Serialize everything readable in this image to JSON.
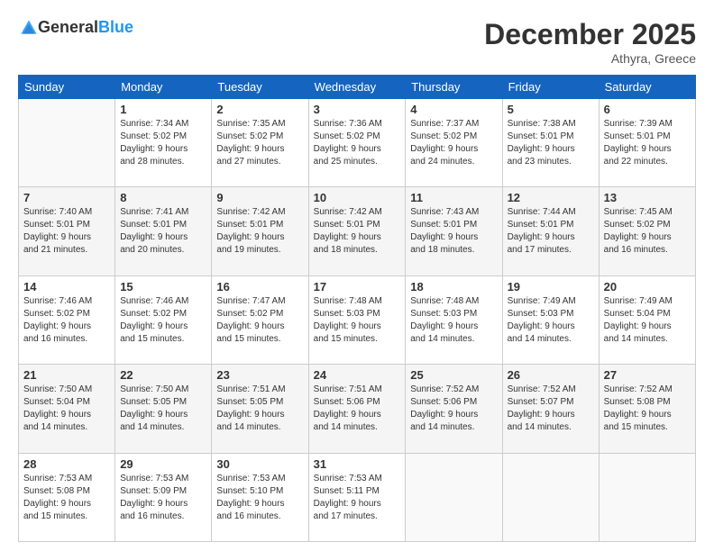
{
  "logo": {
    "text_general": "General",
    "text_blue": "Blue"
  },
  "header": {
    "month_title": "December 2025",
    "location": "Athyra, Greece"
  },
  "weekdays": [
    "Sunday",
    "Monday",
    "Tuesday",
    "Wednesday",
    "Thursday",
    "Friday",
    "Saturday"
  ],
  "weeks": [
    [
      {
        "day": "",
        "info": ""
      },
      {
        "day": "1",
        "info": "Sunrise: 7:34 AM\nSunset: 5:02 PM\nDaylight: 9 hours\nand 28 minutes."
      },
      {
        "day": "2",
        "info": "Sunrise: 7:35 AM\nSunset: 5:02 PM\nDaylight: 9 hours\nand 27 minutes."
      },
      {
        "day": "3",
        "info": "Sunrise: 7:36 AM\nSunset: 5:02 PM\nDaylight: 9 hours\nand 25 minutes."
      },
      {
        "day": "4",
        "info": "Sunrise: 7:37 AM\nSunset: 5:02 PM\nDaylight: 9 hours\nand 24 minutes."
      },
      {
        "day": "5",
        "info": "Sunrise: 7:38 AM\nSunset: 5:01 PM\nDaylight: 9 hours\nand 23 minutes."
      },
      {
        "day": "6",
        "info": "Sunrise: 7:39 AM\nSunset: 5:01 PM\nDaylight: 9 hours\nand 22 minutes."
      }
    ],
    [
      {
        "day": "7",
        "info": "Sunrise: 7:40 AM\nSunset: 5:01 PM\nDaylight: 9 hours\nand 21 minutes."
      },
      {
        "day": "8",
        "info": "Sunrise: 7:41 AM\nSunset: 5:01 PM\nDaylight: 9 hours\nand 20 minutes."
      },
      {
        "day": "9",
        "info": "Sunrise: 7:42 AM\nSunset: 5:01 PM\nDaylight: 9 hours\nand 19 minutes."
      },
      {
        "day": "10",
        "info": "Sunrise: 7:42 AM\nSunset: 5:01 PM\nDaylight: 9 hours\nand 18 minutes."
      },
      {
        "day": "11",
        "info": "Sunrise: 7:43 AM\nSunset: 5:01 PM\nDaylight: 9 hours\nand 18 minutes."
      },
      {
        "day": "12",
        "info": "Sunrise: 7:44 AM\nSunset: 5:01 PM\nDaylight: 9 hours\nand 17 minutes."
      },
      {
        "day": "13",
        "info": "Sunrise: 7:45 AM\nSunset: 5:02 PM\nDaylight: 9 hours\nand 16 minutes."
      }
    ],
    [
      {
        "day": "14",
        "info": "Sunrise: 7:46 AM\nSunset: 5:02 PM\nDaylight: 9 hours\nand 16 minutes."
      },
      {
        "day": "15",
        "info": "Sunrise: 7:46 AM\nSunset: 5:02 PM\nDaylight: 9 hours\nand 15 minutes."
      },
      {
        "day": "16",
        "info": "Sunrise: 7:47 AM\nSunset: 5:02 PM\nDaylight: 9 hours\nand 15 minutes."
      },
      {
        "day": "17",
        "info": "Sunrise: 7:48 AM\nSunset: 5:03 PM\nDaylight: 9 hours\nand 15 minutes."
      },
      {
        "day": "18",
        "info": "Sunrise: 7:48 AM\nSunset: 5:03 PM\nDaylight: 9 hours\nand 14 minutes."
      },
      {
        "day": "19",
        "info": "Sunrise: 7:49 AM\nSunset: 5:03 PM\nDaylight: 9 hours\nand 14 minutes."
      },
      {
        "day": "20",
        "info": "Sunrise: 7:49 AM\nSunset: 5:04 PM\nDaylight: 9 hours\nand 14 minutes."
      }
    ],
    [
      {
        "day": "21",
        "info": "Sunrise: 7:50 AM\nSunset: 5:04 PM\nDaylight: 9 hours\nand 14 minutes."
      },
      {
        "day": "22",
        "info": "Sunrise: 7:50 AM\nSunset: 5:05 PM\nDaylight: 9 hours\nand 14 minutes."
      },
      {
        "day": "23",
        "info": "Sunrise: 7:51 AM\nSunset: 5:05 PM\nDaylight: 9 hours\nand 14 minutes."
      },
      {
        "day": "24",
        "info": "Sunrise: 7:51 AM\nSunset: 5:06 PM\nDaylight: 9 hours\nand 14 minutes."
      },
      {
        "day": "25",
        "info": "Sunrise: 7:52 AM\nSunset: 5:06 PM\nDaylight: 9 hours\nand 14 minutes."
      },
      {
        "day": "26",
        "info": "Sunrise: 7:52 AM\nSunset: 5:07 PM\nDaylight: 9 hours\nand 14 minutes."
      },
      {
        "day": "27",
        "info": "Sunrise: 7:52 AM\nSunset: 5:08 PM\nDaylight: 9 hours\nand 15 minutes."
      }
    ],
    [
      {
        "day": "28",
        "info": "Sunrise: 7:53 AM\nSunset: 5:08 PM\nDaylight: 9 hours\nand 15 minutes."
      },
      {
        "day": "29",
        "info": "Sunrise: 7:53 AM\nSunset: 5:09 PM\nDaylight: 9 hours\nand 16 minutes."
      },
      {
        "day": "30",
        "info": "Sunrise: 7:53 AM\nSunset: 5:10 PM\nDaylight: 9 hours\nand 16 minutes."
      },
      {
        "day": "31",
        "info": "Sunrise: 7:53 AM\nSunset: 5:11 PM\nDaylight: 9 hours\nand 17 minutes."
      },
      {
        "day": "",
        "info": ""
      },
      {
        "day": "",
        "info": ""
      },
      {
        "day": "",
        "info": ""
      }
    ]
  ]
}
